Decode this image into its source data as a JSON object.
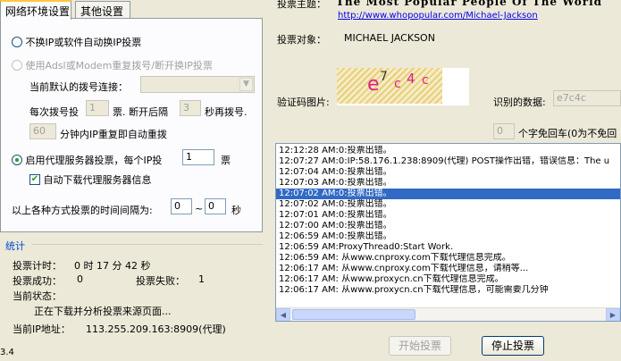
{
  "tabs": [
    {
      "label": "网络环境设置",
      "active": true
    },
    {
      "label": "其他设置",
      "active": false
    }
  ],
  "network": {
    "opt_no_change": "不换IP或软件自动换IP投票",
    "opt_adsl": "使用Adsl或Modem重复拨号/断开换IP投票",
    "dial_conn_label": "当前默认的拨号连接：",
    "dial_every_prefix": "每次拨号投",
    "dial_every_value": "1",
    "dial_every_mid": "票. 断开后隔",
    "dial_wait_value": "3",
    "dial_wait_suffix": "秒再拨号.",
    "repeat_value": "60",
    "repeat_suffix": "分钟内IP重复即自动重拨",
    "opt_proxy": "启用代理服务器投票，每个IP投",
    "proxy_votes_value": "1",
    "proxy_votes_suffix": "票",
    "auto_download": "自动下载代理服务器信息",
    "interval_label": "以上各种方式投票的时间间隔为:",
    "interval_min": "0",
    "interval_tilde": "~",
    "interval_max": "0",
    "interval_unit": "秒"
  },
  "stats": {
    "title": "统计",
    "timer_label": "投票计时：",
    "timer_value": "0 时 17 分 42 秒",
    "success_label": "投票成功：",
    "success_value": "0",
    "fail_label": "投票失败：",
    "fail_value": "1",
    "status_label": "当前状态：",
    "status_value": "正在下载并分析投票来源页面...",
    "ip_label": "当前IP地址：",
    "ip_value": "113.255.209.163:8909(代理)"
  },
  "version": "3.4",
  "vote": {
    "subject_label": "投票主题：",
    "subject_value": "The Most Popular People Of The World",
    "url": "http://www.whopopular.com/Michael-Jackson",
    "target_label": "投票对象：",
    "target_value": "MICHAEL JACKSON",
    "captcha_label": "验证码图片:",
    "captcha_chars": [
      "e",
      "7",
      "c",
      "4",
      "c"
    ],
    "recognized_label": "识别的数据:",
    "recognized_value": "e7c4c",
    "nocaptcha_value": "0",
    "nocaptcha_label": "个字免回车(0为不免回"
  },
  "log": [
    {
      "text": "12:12:28 AM:0:投票出错。",
      "selected": false
    },
    {
      "text": "12:07:27 AM:0:IP:58.176.1.238:8909(代理) POST操作出错，错误信息：The u",
      "selected": false
    },
    {
      "text": "12:07:04 AM:0:投票出错。",
      "selected": false
    },
    {
      "text": "12:07:03 AM:0:投票出错。",
      "selected": false
    },
    {
      "text": "12:07:02 AM:0:投票出错。",
      "selected": true
    },
    {
      "text": "12:07:02 AM:0:投票出错。",
      "selected": false
    },
    {
      "text": "12:07:01 AM:0:投票出错。",
      "selected": false
    },
    {
      "text": "12:07:00 AM:0:投票出错。",
      "selected": false
    },
    {
      "text": "12:06:59 AM:0:投票出错。",
      "selected": false
    },
    {
      "text": "12:06:59 AM:ProxyThread0:Start Work.",
      "selected": false
    },
    {
      "text": "12:06:59 AM: 从www.cnproxy.com下载代理信息完成。",
      "selected": false
    },
    {
      "text": "12:06:17 AM: 从www.cnproxy.com下载代理信息，请稍等...",
      "selected": false
    },
    {
      "text": "12:06:17 AM: 从www.proxycn.cn下载代理信息完成。",
      "selected": false
    },
    {
      "text": "12:06:17 AM: 从www.proxycn.cn下载代理信息，可能需要几分钟",
      "selected": false
    }
  ],
  "buttons": {
    "start": "开始投票",
    "stop": "停止投票"
  },
  "icons": {
    "scroll_left": "scroll-left-icon",
    "scroll_right": "scroll-right-icon",
    "dropdown": "chevron-down-icon",
    "check": "check-icon"
  }
}
